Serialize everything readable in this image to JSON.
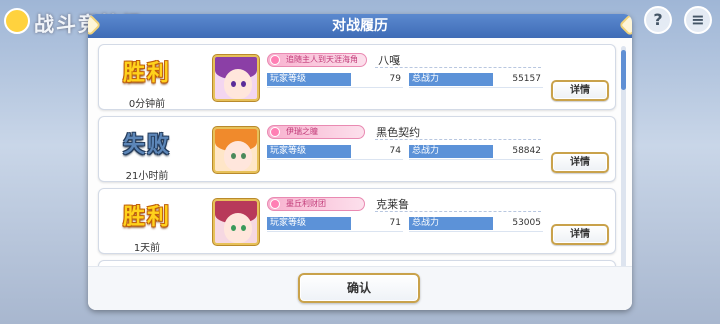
{
  "background": {
    "screen_title": "战斗竞技场",
    "help_label": "?",
    "menu_label": "≡"
  },
  "dialog": {
    "title": "对战履历",
    "confirm_label": "确认"
  },
  "records": [
    {
      "result": "胜利",
      "result_type": "win",
      "time": "0分钟前",
      "title_badge": "追随主人到天涯海角",
      "player_name": "八嘎",
      "level_label": "玩家等级",
      "level": "79",
      "power_label": "总战力",
      "power": "55157",
      "detail_label": "详情",
      "avatar_colors": {
        "hair": "#8b3fa6",
        "eye": "#5a2c9a",
        "bg": "#f3d6f0"
      }
    },
    {
      "result": "失败",
      "result_type": "lose",
      "time": "21小时前",
      "title_badge": "伊瑞之瞳",
      "player_name": "黑色契约",
      "level_label": "玩家等级",
      "level": "74",
      "power_label": "总战力",
      "power": "58842",
      "detail_label": "详情",
      "avatar_colors": {
        "hair": "#f08a2c",
        "eye": "#4b8a5c",
        "bg": "#ffe6c8"
      }
    },
    {
      "result": "胜利",
      "result_type": "win",
      "time": "1天前",
      "title_badge": "墨丘利财团",
      "player_name": "克莱鲁",
      "level_label": "玩家等级",
      "level": "71",
      "power_label": "总战力",
      "power": "53005",
      "detail_label": "详情",
      "avatar_colors": {
        "hair": "#b83a5a",
        "eye": "#3a9a5a",
        "bg": "#f6d8e2"
      }
    }
  ],
  "colors": {
    "header": "#4a78c2",
    "win_text": "#ffd21c",
    "lose_text": "#5c86b8",
    "stat_label_bg": "#5c92d8",
    "button_border": "#c9a24b"
  }
}
